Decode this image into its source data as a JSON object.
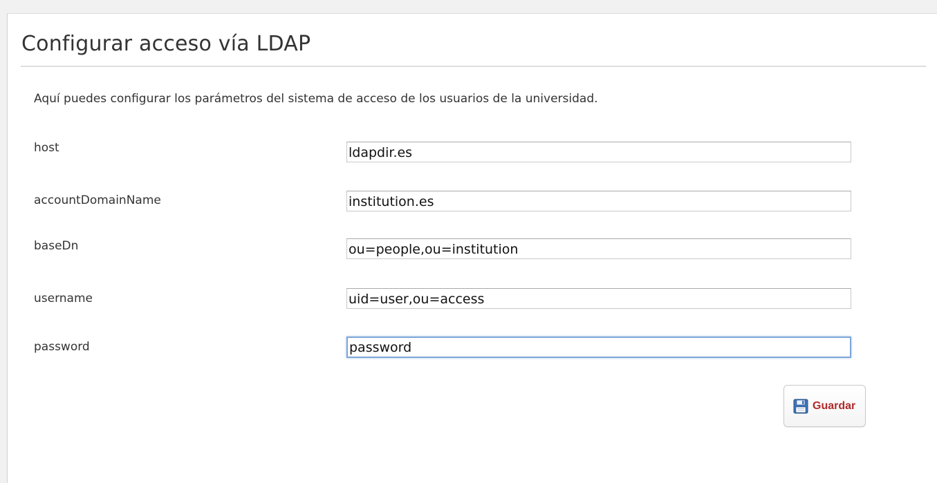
{
  "page": {
    "title": "Configurar acceso vía LDAP",
    "intro": "Aquí puedes configurar los parámetros del sistema de acceso de los usuarios de la universidad."
  },
  "form": {
    "fields": [
      {
        "label": "host",
        "value": "ldapdir.es"
      },
      {
        "label": "accountDomainName",
        "value": "institution.es"
      },
      {
        "label": "baseDn",
        "value": "ou=people,ou=institution"
      },
      {
        "label": "username",
        "value": "uid=user,ou=access"
      },
      {
        "label": "password",
        "value": "password"
      }
    ],
    "focused_field": "password",
    "save_button": {
      "label": "Guardar",
      "icon": "floppy-disk-icon"
    }
  },
  "colors": {
    "accent_text": "#b02a2a",
    "focus_border": "#7fa6d8"
  }
}
